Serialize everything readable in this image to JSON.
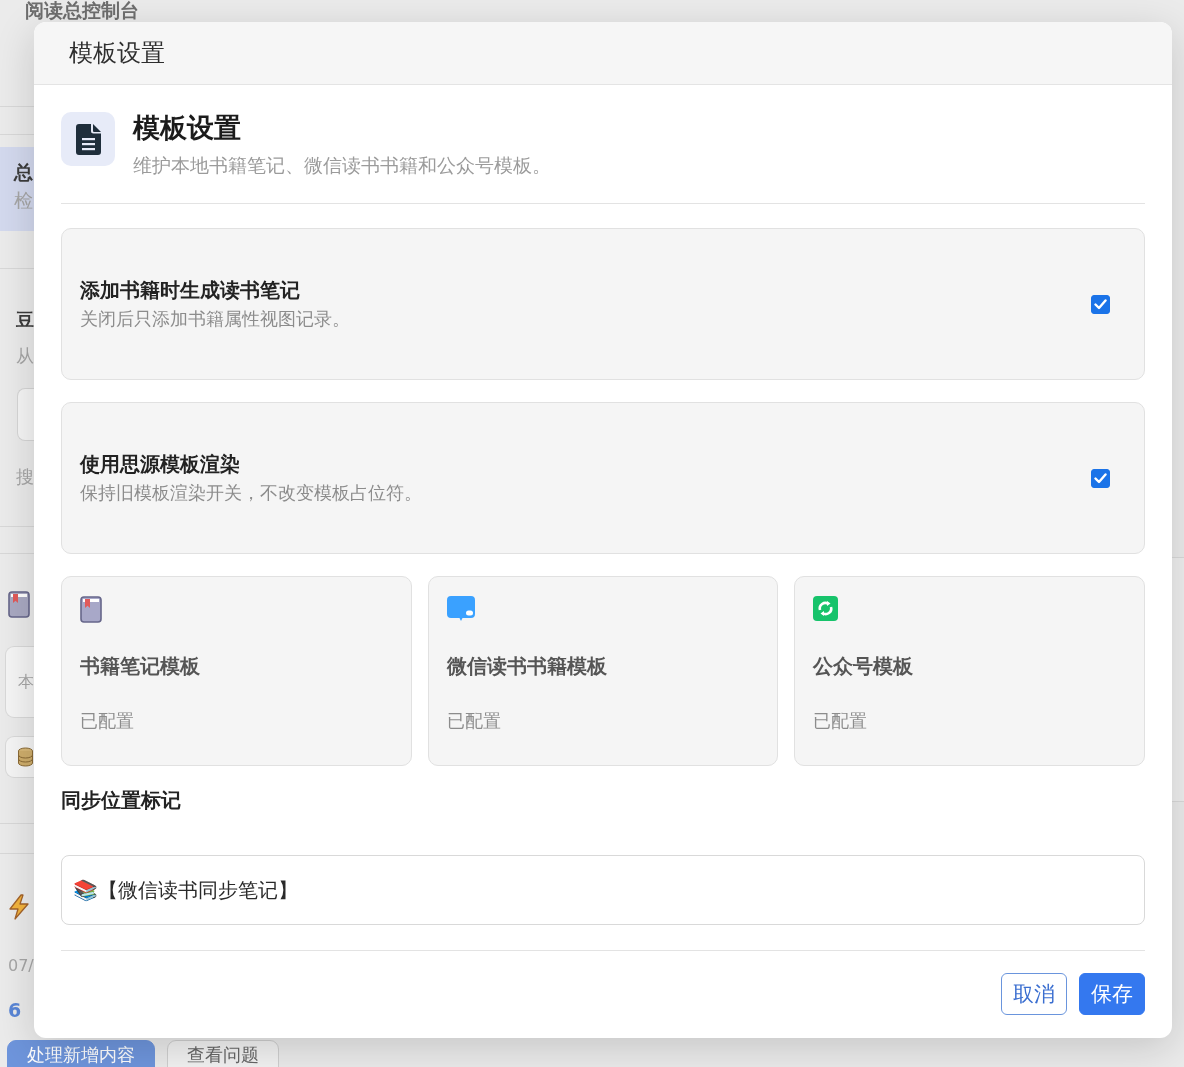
{
  "background_page": {
    "heading": "阅读总控制台",
    "left_column": [
      {
        "kind": "card",
        "selected": true,
        "title": "总",
        "text": "检"
      },
      {
        "kind": "section",
        "title": "豆",
        "text": "从",
        "caption": "搜"
      },
      {
        "kind": "list",
        "field_text": "本"
      },
      {
        "kind": "log",
        "date": "07/",
        "count": "6"
      }
    ],
    "buttons": [
      {
        "label": "处理新增内容",
        "primary": true
      },
      {
        "label": "查看问题",
        "primary": false
      }
    ]
  },
  "dialog": {
    "title": "模板设置"
  },
  "header": {
    "title": "模板设置",
    "description": "维护本地书籍笔记、微信读书书籍和公众号模板。"
  },
  "toggles": [
    {
      "title": "添加书籍时生成读书笔记",
      "description": "关闭后只添加书籍属性视图记录。",
      "checked": true
    },
    {
      "title": "使用思源模板渲染",
      "description": "保持旧模板渲染开关，不改变模板占位符。",
      "checked": true
    }
  ],
  "templates": [
    {
      "kind": "book",
      "title": "书籍笔记模板",
      "status": "已配置"
    },
    {
      "kind": "weread",
      "title": "微信读书书籍模板",
      "status": "已配置"
    },
    {
      "kind": "wechat",
      "title": "公众号模板",
      "status": "已配置"
    }
  ],
  "sync_marker": {
    "label": "同步位置标记",
    "value": "📚【微信读书同步笔记】"
  },
  "buttons": [
    {
      "label": "取消",
      "primary": false
    },
    {
      "label": "保存",
      "primary": true
    }
  ]
}
